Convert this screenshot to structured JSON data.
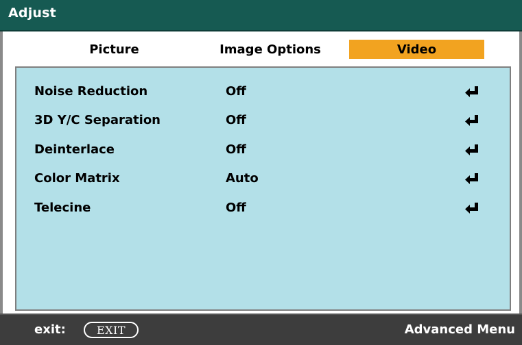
{
  "window": {
    "title": "Adjust"
  },
  "tabs": [
    {
      "label": "Picture",
      "selected": false
    },
    {
      "label": "Image Options",
      "selected": false
    },
    {
      "label": "Video",
      "selected": true
    }
  ],
  "settings": [
    {
      "label": "Noise Reduction",
      "value": "Off",
      "icon": "enter-icon"
    },
    {
      "label": "3D Y/C Separation",
      "value": "Off",
      "icon": "enter-icon"
    },
    {
      "label": "Deinterlace",
      "value": "Off",
      "icon": "enter-icon"
    },
    {
      "label": "Color Matrix",
      "value": "Auto",
      "icon": "enter-icon"
    },
    {
      "label": "Telecine",
      "value": "Off",
      "icon": "enter-icon"
    }
  ],
  "footer": {
    "exit_label": "exit:",
    "exit_button": "EXIT",
    "right_label": "Advanced Menu"
  },
  "colors": {
    "titlebar": "#165a52",
    "selected_tab": "#f2a320",
    "panel": "#b3e0e8",
    "footer": "#3d3d3d"
  }
}
